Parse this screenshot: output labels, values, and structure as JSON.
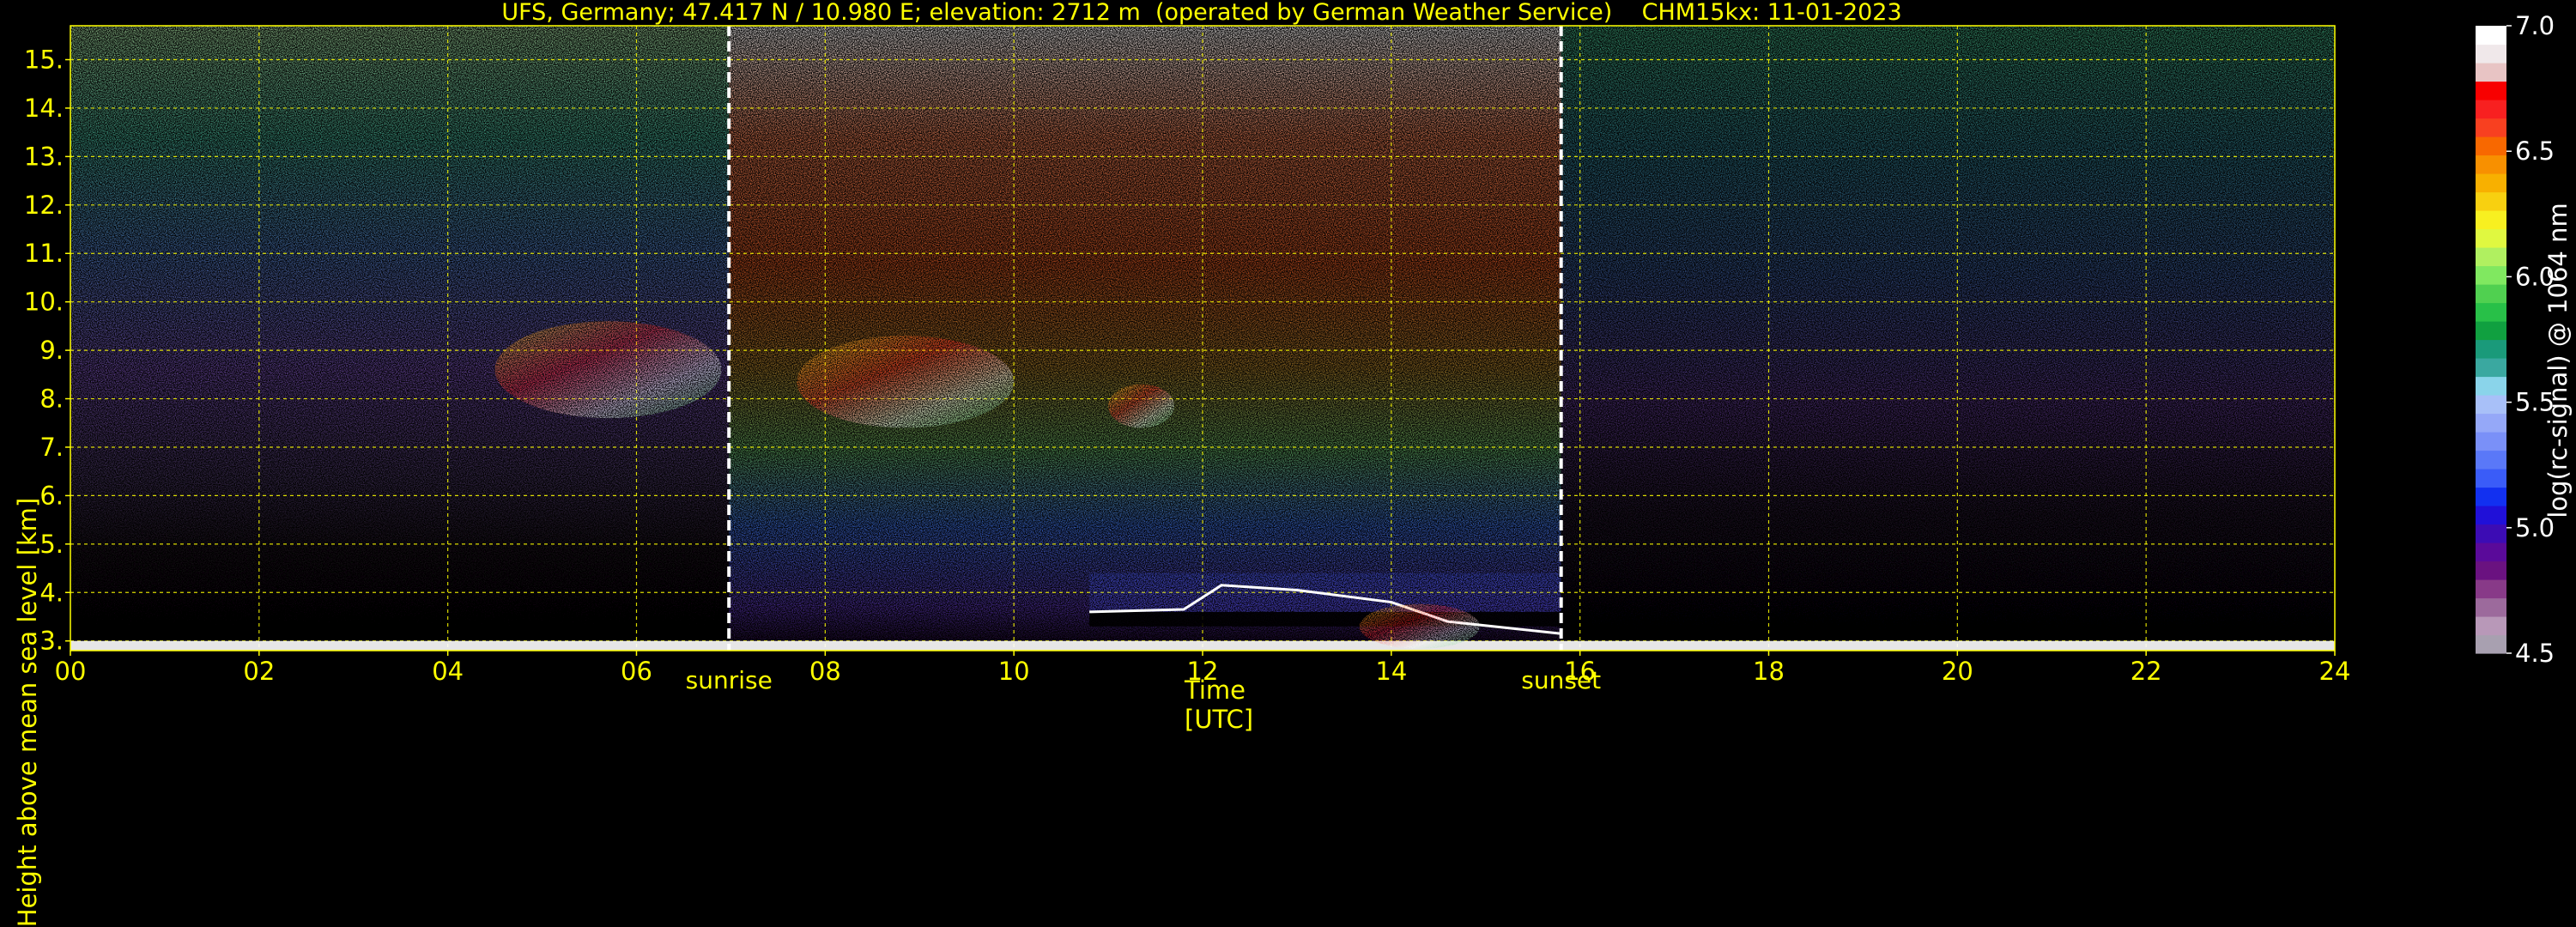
{
  "chart_data": {
    "type": "heatmap",
    "title": "UFS, Germany; 47.417 N / 10.980 E; elevation: 2712 m  (operated by German Weather Service)    CHM15kx: 11-01-2023",
    "xlabel": "Time [UTC]",
    "ylabel": "Height above mean sea level [km]",
    "xlim": [
      0,
      24
    ],
    "ylim": [
      2.8,
      15.7
    ],
    "x_ticks": [
      "00",
      "02",
      "04",
      "06",
      "08",
      "10",
      "12",
      "14",
      "16",
      "18",
      "20",
      "22",
      "24"
    ],
    "y_ticks": [
      "3.",
      "4.",
      "5.",
      "6.",
      "7.",
      "8.",
      "9.",
      "10.",
      "11.",
      "12.",
      "13.",
      "14.",
      "15."
    ],
    "grid": true,
    "markers": [
      {
        "label": "sunrise",
        "x": 6.98
      },
      {
        "label": "sunset",
        "x": 15.8
      }
    ],
    "colorbar": {
      "label": "log(rc-signal) @ 1064 nm",
      "range": [
        4.5,
        7.0
      ],
      "ticks": [
        "4.5",
        "5.0",
        "5.5",
        "6.0",
        "6.5",
        "7.0"
      ],
      "colors": [
        "#a8a0b0",
        "#b898b8",
        "#9c6a9c",
        "#883a88",
        "#6a1280",
        "#5a0a9a",
        "#3c0cb4",
        "#2010d8",
        "#1230f0",
        "#3a5cf8",
        "#5a78f8",
        "#7a90f8",
        "#95a8f8",
        "#a8c0f8",
        "#8ad4ea",
        "#3aa8a0",
        "#1a9a7a",
        "#10a040",
        "#28c048",
        "#50d050",
        "#80e860",
        "#b0f060",
        "#e0f840",
        "#f8f020",
        "#f8d010",
        "#f8b000",
        "#f89000",
        "#f86800",
        "#f84020",
        "#f82020",
        "#f80000",
        "#e8c4c4",
        "#f0e8ea",
        "#ffffff"
      ]
    },
    "features": [
      {
        "name": "surface signal band",
        "x": [
          0,
          24
        ],
        "y": [
          2.8,
          3.0
        ]
      },
      {
        "name": "cirrus layer",
        "x": [
          4.5,
          6.9
        ],
        "y": [
          7.6,
          9.6
        ]
      },
      {
        "name": "cirrus fragments",
        "x": [
          7.7,
          10.0
        ],
        "y": [
          7.4,
          9.3
        ]
      },
      {
        "name": "cirrus fragments",
        "x": [
          11.0,
          11.7
        ],
        "y": [
          7.4,
          8.3
        ]
      },
      {
        "name": "boundary layer top",
        "x": [
          10.8,
          15.8
        ],
        "y": [
          3.3,
          4.4
        ]
      }
    ]
  }
}
